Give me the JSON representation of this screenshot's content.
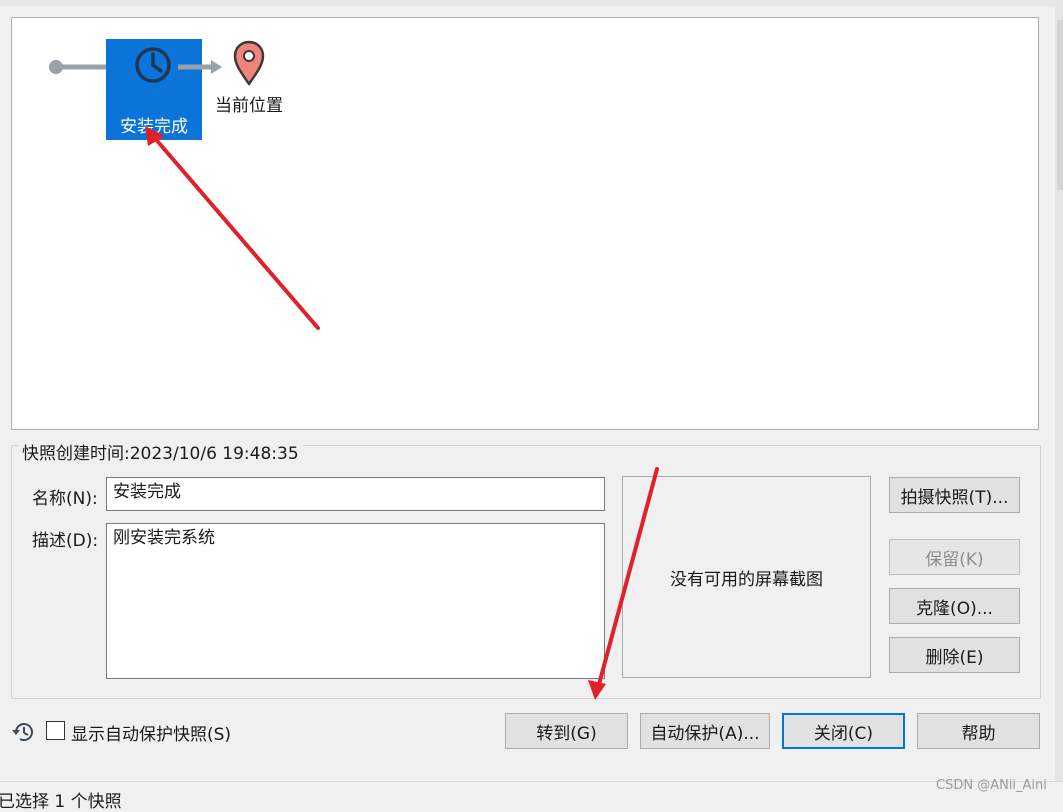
{
  "tree": {
    "snapshot_label": "安装完成",
    "current_label": "当前位置",
    "snapshot_color": "#0a74d9",
    "pin_color": "#f0837a"
  },
  "details": {
    "created_label": "快照创建时间:2023/10/6 19:48:35",
    "name_label": "名称(N):",
    "name_value": "安装完成",
    "desc_label": "描述(D):",
    "desc_value": "刚安装完系统",
    "no_screenshot": "没有可用的屏幕截图"
  },
  "buttons": {
    "take_snapshot": "拍摄快照(T)...",
    "keep": "保留(K)",
    "clone": "克隆(O)...",
    "delete": "删除(E)",
    "goto": "转到(G)",
    "autoprotect": "自动保护(A)...",
    "close": "关闭(C)",
    "help": "帮助"
  },
  "footer": {
    "show_autoprotect": "显示自动保护快照(S)",
    "status": "已选择 1 个快照",
    "watermark": "CSDN @ANii_Aini"
  },
  "icons": {
    "history": "history-icon",
    "clock": "clock-icon",
    "pin": "location-pin-icon"
  },
  "colors": {
    "accent": "#0078d7",
    "annotation_arrow": "#e0202a"
  }
}
